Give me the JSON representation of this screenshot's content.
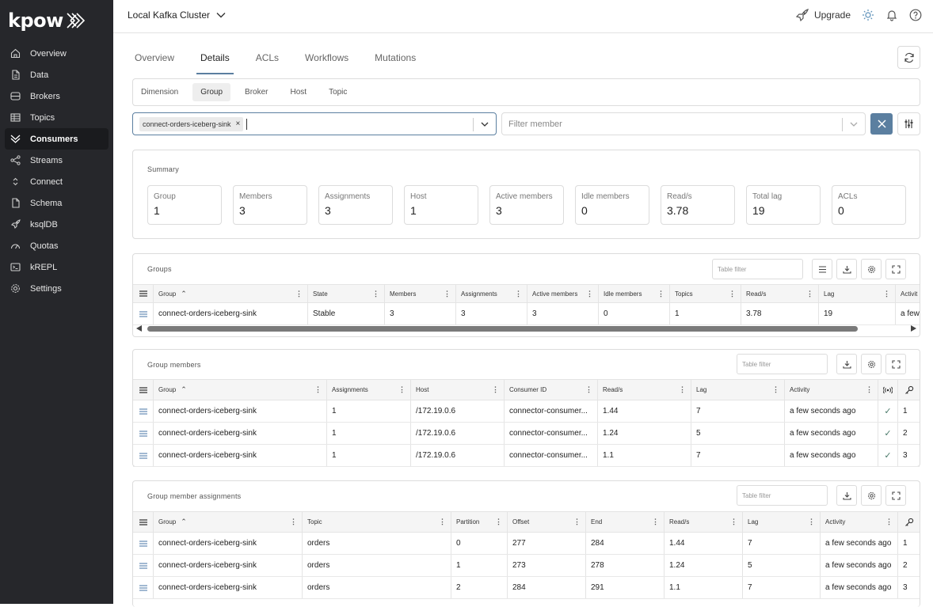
{
  "brand": {
    "name": "kpow"
  },
  "sidebar": {
    "items": [
      {
        "label": "Overview",
        "icon": "home-icon"
      },
      {
        "label": "Data",
        "icon": "file-icon"
      },
      {
        "label": "Brokers",
        "icon": "server-icon"
      },
      {
        "label": "Topics",
        "icon": "table-icon"
      },
      {
        "label": "Consumers",
        "icon": "consumers-icon",
        "active": true
      },
      {
        "label": "Streams",
        "icon": "share-icon"
      },
      {
        "label": "Connect",
        "icon": "connect-icon"
      },
      {
        "label": "Schema",
        "icon": "schema-icon"
      },
      {
        "label": "ksqlDB",
        "icon": "rocket-icon"
      },
      {
        "label": "Quotas",
        "icon": "quota-icon"
      },
      {
        "label": "kREPL",
        "icon": "terminal-icon"
      },
      {
        "label": "Settings",
        "icon": "gear-icon"
      }
    ]
  },
  "header": {
    "cluster": "Local Kafka Cluster",
    "upgrade": "Upgrade"
  },
  "tabs": [
    "Overview",
    "Details",
    "ACLs",
    "Workflows",
    "Mutations"
  ],
  "active_tab": "Details",
  "dimension": {
    "label": "Dimension",
    "options": [
      "Group",
      "Broker",
      "Host",
      "Topic"
    ],
    "selected": "Group"
  },
  "filters": {
    "group_chip": "connect-orders-iceberg-sink",
    "member_placeholder": "Filter member"
  },
  "summary": {
    "title": "Summary",
    "stats": [
      {
        "label": "Group",
        "value": "1"
      },
      {
        "label": "Members",
        "value": "3"
      },
      {
        "label": "Assignments",
        "value": "3"
      },
      {
        "label": "Host",
        "value": "1"
      },
      {
        "label": "Active members",
        "value": "3"
      },
      {
        "label": "Idle members",
        "value": "0"
      },
      {
        "label": "Read/s",
        "value": "3.78"
      },
      {
        "label": "Total lag",
        "value": "19"
      },
      {
        "label": "ACLs",
        "value": "0"
      }
    ]
  },
  "table_filter_placeholder": "Table filter",
  "groups": {
    "title": "Groups",
    "columns": [
      "Group",
      "State",
      "Members",
      "Assignments",
      "Active members",
      "Idle members",
      "Topics",
      "Read/s",
      "Lag",
      "Activit"
    ],
    "rows": [
      [
        "connect-orders-iceberg-sink",
        "Stable",
        "3",
        "3",
        "3",
        "0",
        "1",
        "3.78",
        "19",
        "a few"
      ]
    ]
  },
  "members": {
    "title": "Group members",
    "columns": [
      "Group",
      "Assignments",
      "Host",
      "Consumer ID",
      "Read/s",
      "Lag",
      "Activity"
    ],
    "rows": [
      [
        "connect-orders-iceberg-sink",
        "1",
        "/172.19.0.6",
        "connector-consumer...",
        "1.44",
        "7",
        "a few seconds ago",
        "1"
      ],
      [
        "connect-orders-iceberg-sink",
        "1",
        "/172.19.0.6",
        "connector-consumer...",
        "1.24",
        "5",
        "a few seconds ago",
        "2"
      ],
      [
        "connect-orders-iceberg-sink",
        "1",
        "/172.19.0.6",
        "connector-consumer...",
        "1.1",
        "7",
        "a few seconds ago",
        "3"
      ]
    ]
  },
  "assignments": {
    "title": "Group member assignments",
    "columns": [
      "Group",
      "Topic",
      "Partition",
      "Offset",
      "End",
      "Read/s",
      "Lag",
      "Activity"
    ],
    "rows": [
      [
        "connect-orders-iceberg-sink",
        "orders",
        "0",
        "277",
        "284",
        "1.44",
        "7",
        "a few seconds ago",
        "1"
      ],
      [
        "connect-orders-iceberg-sink",
        "orders",
        "1",
        "273",
        "278",
        "1.24",
        "5",
        "a few seconds ago",
        "2"
      ],
      [
        "connect-orders-iceberg-sink",
        "orders",
        "2",
        "284",
        "291",
        "1.1",
        "7",
        "a few seconds ago",
        "3"
      ]
    ]
  }
}
